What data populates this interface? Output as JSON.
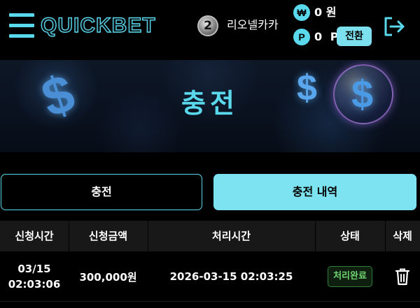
{
  "header": {
    "logo": "QUICKBET",
    "level": "2",
    "username": "리오넬카카",
    "won_symbol": "₩",
    "won_balance": "0 원",
    "point_symbol": "P",
    "point_balance": "0 P",
    "convert_label": "전환",
    "menu_icon": "hamburger-menu-icon",
    "logout_icon": "logout-icon"
  },
  "banner": {
    "title": "충전"
  },
  "tabs": [
    {
      "label": "충전",
      "active": false
    },
    {
      "label": "충전 내역",
      "active": true
    }
  ],
  "table": {
    "headers": [
      "신청시간",
      "신청금액",
      "처리시간",
      "상태",
      "삭제"
    ],
    "rows": [
      {
        "request_date": "03/15",
        "request_time": "02:03:06",
        "amount": "300,000원",
        "processed_at": "2026-03-15 02:03:25",
        "status": "처리완료",
        "delete_icon": "trash-icon"
      }
    ]
  },
  "colors": {
    "accent": "#5ad8ec",
    "active_tab": "#7de3f1",
    "status_green": "#6fd46f"
  }
}
